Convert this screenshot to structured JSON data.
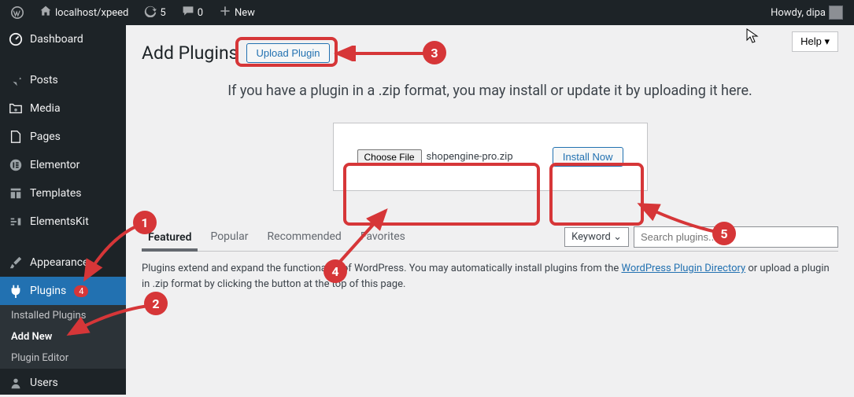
{
  "adminbar": {
    "site_name": "localhost/xpeed",
    "updates": "5",
    "comments": "0",
    "new_label": "New",
    "howdy": "Howdy, dipa"
  },
  "sidebar": {
    "items": [
      {
        "label": "Dashboard"
      },
      {
        "label": "Posts"
      },
      {
        "label": "Media"
      },
      {
        "label": "Pages"
      },
      {
        "label": "Elementor"
      },
      {
        "label": "Templates"
      },
      {
        "label": "ElementsKit"
      },
      {
        "label": "Appearance"
      },
      {
        "label": "Plugins",
        "badge": "4"
      },
      {
        "label": "Users"
      }
    ],
    "submenu": [
      {
        "label": "Installed Plugins"
      },
      {
        "label": "Add New"
      },
      {
        "label": "Plugin Editor"
      }
    ]
  },
  "page": {
    "title": "Add Plugins",
    "upload_btn": "Upload Plugin",
    "help_btn": "Help ▾",
    "hint": "If you have a plugin in a .zip format, you may install or update it by uploading it here.",
    "choose_file": "Choose File",
    "filename": "shopengine-pro.zip",
    "install_now": "Install Now",
    "tabs": [
      "Featured",
      "Popular",
      "Recommended",
      "Favorites"
    ],
    "keyword": "Keyword ⌄",
    "search_placeholder": "Search plugins...",
    "desc_before": "Plugins extend and expand the functionality of WordPress. You may automatically install plugins from the ",
    "desc_link": "WordPress Plugin Directory",
    "desc_after": " or upload a plugin in .zip format by clicking the button at the top of this page."
  },
  "annotations": {
    "n1": "1",
    "n2": "2",
    "n3": "3",
    "n4": "4",
    "n5": "5"
  }
}
